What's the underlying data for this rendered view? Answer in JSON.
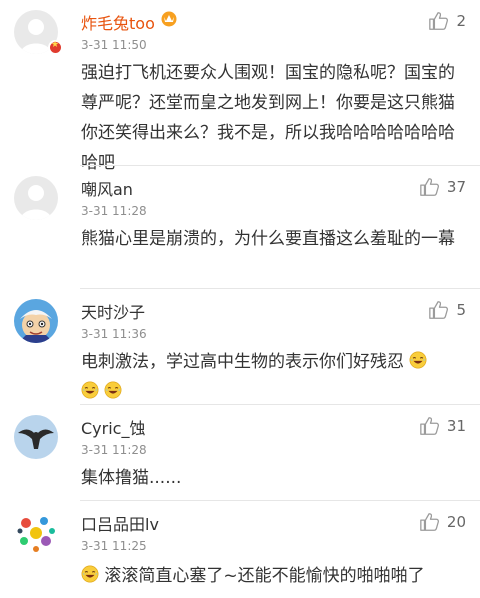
{
  "comments": [
    {
      "username": "炸毛兔too",
      "time": "3-31 11:50",
      "likes": "2",
      "text": "强迫打飞机还要众人围观！国宝的隐私呢？国宝的尊严呢？还堂而皇之地发到网上！你要是这只熊猫你还笑得出来么？我不是，所以我哈哈哈哈哈哈哈哈吧",
      "vip_color": "#e8540f"
    },
    {
      "username": "嘲风an",
      "time": "3-31 11:28",
      "likes": "37",
      "text": "熊猫心里是崩溃的，为什么要直播这么羞耻的一幕"
    },
    {
      "username": "天时沙子",
      "time": "3-31 11:36",
      "likes": "5",
      "text": "电刺激法，学过高中生物的表示你们好残忍"
    },
    {
      "username": "Cyric_蚀",
      "time": "3-31 11:28",
      "likes": "31",
      "text": "集体撸猫......"
    },
    {
      "username": "口吕品田lv",
      "time": "3-31 11:25",
      "likes": "20",
      "text": "滚滚简直心塞了~还能不能愉快的啪啪啪了"
    }
  ],
  "icons": {
    "like": "thumbs-up-icon",
    "laugh_emoji": "laughing-emoji-icon",
    "crown": "vip-crown-icon"
  }
}
